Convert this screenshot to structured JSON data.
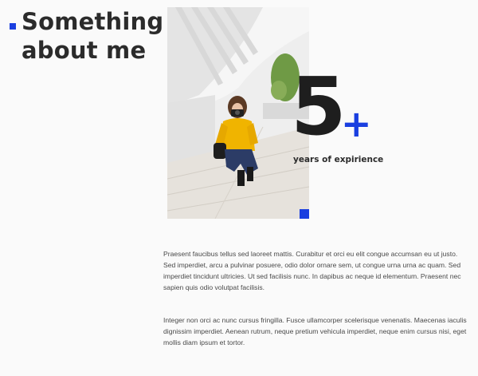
{
  "section": {
    "heading": "Something about me"
  },
  "photo": {
    "alt": "Woman in yellow sweater crouching with camera on white steps"
  },
  "stat": {
    "number": "5",
    "plus": "+",
    "caption": "years of expirience"
  },
  "paragraphs": [
    "Praesent faucibus tellus sed laoreet mattis. Curabitur et orci eu elit congue accumsan eu ut justo. Sed imperdiet, arcu a pulvinar posuere, odio dolor ornare sem, ut congue urna urna ac quam. Sed imperdiet tincidunt ultricies. Ut sed facilisis nunc. In dapibus ac neque id elementum. Praesent nec sapien quis odio volutpat facilisis.",
    "Integer non orci ac nunc cursus fringilla. Fusce ullamcorper scelerisque venenatis. Maecenas iaculis dignissim imperdiet. Aenean rutrum, neque pretium vehicula imperdiet, neque enim cursus nisi, eget mollis diam ipsum et tortor."
  ],
  "colors": {
    "accent": "#1a3fe0",
    "heading": "#2b2b2b",
    "body_text": "#4a4a4a",
    "background": "#fafafa"
  }
}
